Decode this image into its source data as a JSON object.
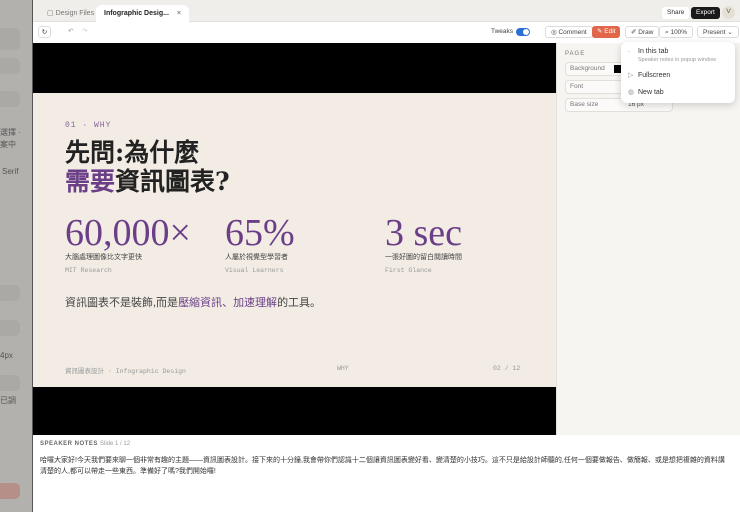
{
  "left_panel": {
    "texts": [
      "選擇 ·",
      "案中",
      "Serif",
      "4px",
      "已調"
    ]
  },
  "tabs": [
    {
      "label": "Design Files",
      "active": false
    },
    {
      "label": "Infographic Desig...",
      "active": true
    }
  ],
  "header": {
    "share": "Share",
    "export": "Export",
    "avatar": "V"
  },
  "toolbar": {
    "tweaks_label": "Tweaks",
    "tweaks_on": true,
    "comment": "Comment",
    "edit": "Edit",
    "draw": "Draw",
    "zoom": "100%",
    "present": "Present"
  },
  "present_menu": [
    {
      "label": "In this tab",
      "sub": "Speaker notes in popup window",
      "icon": "cursor-icon"
    },
    {
      "label": "Fullscreen",
      "icon": "play-icon"
    },
    {
      "label": "New tab",
      "icon": "globe-icon"
    }
  ],
  "right_panel": {
    "section": "PAGE",
    "background_label": "Background",
    "background_color": "#000000",
    "font_label": "Font",
    "base_size_label": "Base size",
    "base_size_value": "16 px"
  },
  "slide": {
    "kicker": "01 · WHY",
    "title_line1": "先問:為什麼",
    "title_line2_accent": "需要",
    "title_line2_rest": "資訊圖表?",
    "stats": [
      {
        "num": "60,000×",
        "zh": "大腦處理圖像比文字更快",
        "en": "MIT Research"
      },
      {
        "num": "65%",
        "zh": "人屬於視覺型學習者",
        "en": "Visual Learners"
      },
      {
        "num": "3 sec",
        "zh": "一張好圖的留白閱讀時間",
        "en": "First Glance"
      }
    ],
    "body_pre": "資訊圖表不是裝飾,而是",
    "body_accent1": "壓縮資訊",
    "body_sep": "、",
    "body_accent2": "加速理解",
    "body_post": "的工具。",
    "footer_left": "資訊圖表設計 · Infographic Design",
    "footer_mid": "WHY",
    "footer_right": "02 / 12"
  },
  "notes": {
    "label": "SPEAKER NOTES",
    "slide": "Slide 1 / 12",
    "text": "哈囉大家好!今天我們要來聊一個非常有趣的主題——資訊圖表設計。接下來的十分鐘,我會帶你們認識十二個讓資訊圖表變好看、變清楚的小技巧。這不只是給設計師聽的,任何一個要做報告、做簡報、或是想把複雜的資料講清楚的人,都可以帶走一些東西。準備好了嗎?我們開始囉!"
  },
  "colors": {
    "accent": "#6b3f88",
    "edit": "#e0674a",
    "slide_bg": "#f2ece4"
  }
}
